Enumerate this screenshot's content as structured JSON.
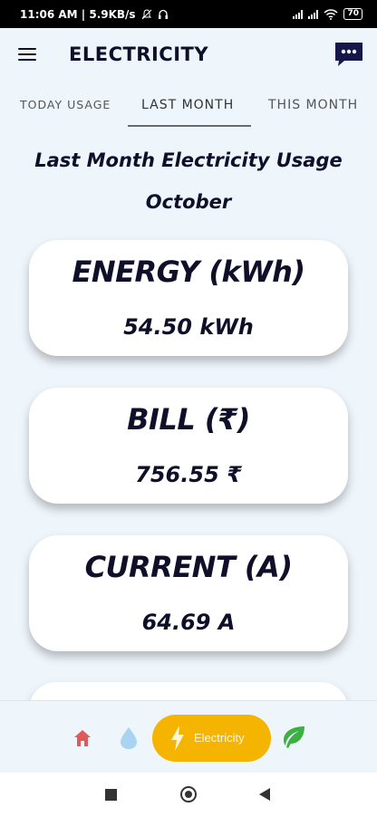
{
  "status_bar": {
    "time_speed": "11:06 AM | 5.9KB/s",
    "battery": "70"
  },
  "app_bar": {
    "title": "ELECTRICITY"
  },
  "tabs": [
    {
      "label": "TODAY USAGE"
    },
    {
      "label": "LAST MONTH",
      "selected": true
    },
    {
      "label": "THIS MONTH"
    }
  ],
  "heading": {
    "line1": "Last Month Electricity Usage",
    "line2": "October"
  },
  "cards": [
    {
      "title": "ENERGY (kWh)",
      "value": "54.50 kWh"
    },
    {
      "title": "BILL (₹)",
      "value": "756.55 ₹"
    },
    {
      "title": "CURRENT (A)",
      "value": "64.69 A"
    }
  ],
  "bottom_nav": {
    "active_label": "Electricity",
    "items": [
      "home-icon",
      "water-drop-icon",
      "bolt-icon",
      "leaf-icon"
    ]
  },
  "colors": {
    "background": "#eef5fb",
    "text_dark": "#0f0f2a",
    "active_pill": "#f4b400",
    "home_icon": "#e05a5a",
    "water_icon": "#a8d4f2",
    "leaf_icon": "#3cb043"
  }
}
